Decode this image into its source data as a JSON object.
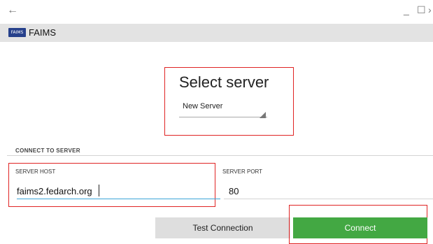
{
  "titlebar": {
    "back_icon": "←",
    "minimize_icon": "_",
    "maximize_icon": "☐",
    "more_icon": "›"
  },
  "appbar": {
    "logo_text": "FAIMS",
    "title": "FAIMS"
  },
  "select_server": {
    "title": "Select server",
    "selected_value": "New Server"
  },
  "connect_section": {
    "label": "CONNECT TO SERVER",
    "server_host_label": "SERVER HOST",
    "server_host_value": "faims2.fedarch.org",
    "server_port_label": "SERVER PORT",
    "server_port_value": "80"
  },
  "buttons": {
    "test_connection": "Test Connection",
    "connect": "Connect"
  },
  "colors": {
    "connect_button": "#43a843",
    "highlight_box": "#e02424",
    "focused_underline": "#3aa4d8"
  }
}
